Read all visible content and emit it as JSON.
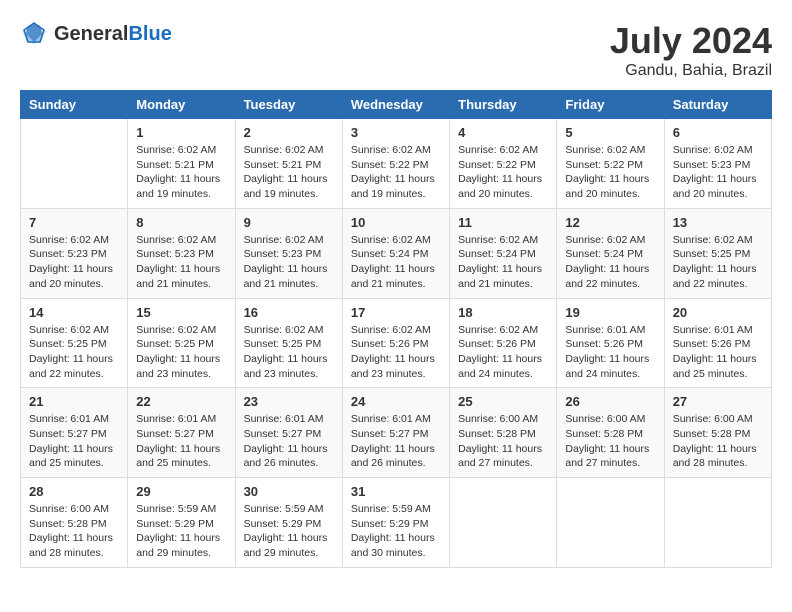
{
  "logo": {
    "general": "General",
    "blue": "Blue"
  },
  "title": {
    "month_year": "July 2024",
    "location": "Gandu, Bahia, Brazil"
  },
  "days_header": [
    "Sunday",
    "Monday",
    "Tuesday",
    "Wednesday",
    "Thursday",
    "Friday",
    "Saturday"
  ],
  "weeks": [
    [
      {
        "day": "",
        "info": ""
      },
      {
        "day": "1",
        "info": "Sunrise: 6:02 AM\nSunset: 5:21 PM\nDaylight: 11 hours\nand 19 minutes."
      },
      {
        "day": "2",
        "info": "Sunrise: 6:02 AM\nSunset: 5:21 PM\nDaylight: 11 hours\nand 19 minutes."
      },
      {
        "day": "3",
        "info": "Sunrise: 6:02 AM\nSunset: 5:22 PM\nDaylight: 11 hours\nand 19 minutes."
      },
      {
        "day": "4",
        "info": "Sunrise: 6:02 AM\nSunset: 5:22 PM\nDaylight: 11 hours\nand 20 minutes."
      },
      {
        "day": "5",
        "info": "Sunrise: 6:02 AM\nSunset: 5:22 PM\nDaylight: 11 hours\nand 20 minutes."
      },
      {
        "day": "6",
        "info": "Sunrise: 6:02 AM\nSunset: 5:23 PM\nDaylight: 11 hours\nand 20 minutes."
      }
    ],
    [
      {
        "day": "7",
        "info": "Sunrise: 6:02 AM\nSunset: 5:23 PM\nDaylight: 11 hours\nand 20 minutes."
      },
      {
        "day": "8",
        "info": "Sunrise: 6:02 AM\nSunset: 5:23 PM\nDaylight: 11 hours\nand 21 minutes."
      },
      {
        "day": "9",
        "info": "Sunrise: 6:02 AM\nSunset: 5:23 PM\nDaylight: 11 hours\nand 21 minutes."
      },
      {
        "day": "10",
        "info": "Sunrise: 6:02 AM\nSunset: 5:24 PM\nDaylight: 11 hours\nand 21 minutes."
      },
      {
        "day": "11",
        "info": "Sunrise: 6:02 AM\nSunset: 5:24 PM\nDaylight: 11 hours\nand 21 minutes."
      },
      {
        "day": "12",
        "info": "Sunrise: 6:02 AM\nSunset: 5:24 PM\nDaylight: 11 hours\nand 22 minutes."
      },
      {
        "day": "13",
        "info": "Sunrise: 6:02 AM\nSunset: 5:25 PM\nDaylight: 11 hours\nand 22 minutes."
      }
    ],
    [
      {
        "day": "14",
        "info": "Sunrise: 6:02 AM\nSunset: 5:25 PM\nDaylight: 11 hours\nand 22 minutes."
      },
      {
        "day": "15",
        "info": "Sunrise: 6:02 AM\nSunset: 5:25 PM\nDaylight: 11 hours\nand 23 minutes."
      },
      {
        "day": "16",
        "info": "Sunrise: 6:02 AM\nSunset: 5:25 PM\nDaylight: 11 hours\nand 23 minutes."
      },
      {
        "day": "17",
        "info": "Sunrise: 6:02 AM\nSunset: 5:26 PM\nDaylight: 11 hours\nand 23 minutes."
      },
      {
        "day": "18",
        "info": "Sunrise: 6:02 AM\nSunset: 5:26 PM\nDaylight: 11 hours\nand 24 minutes."
      },
      {
        "day": "19",
        "info": "Sunrise: 6:01 AM\nSunset: 5:26 PM\nDaylight: 11 hours\nand 24 minutes."
      },
      {
        "day": "20",
        "info": "Sunrise: 6:01 AM\nSunset: 5:26 PM\nDaylight: 11 hours\nand 25 minutes."
      }
    ],
    [
      {
        "day": "21",
        "info": "Sunrise: 6:01 AM\nSunset: 5:27 PM\nDaylight: 11 hours\nand 25 minutes."
      },
      {
        "day": "22",
        "info": "Sunrise: 6:01 AM\nSunset: 5:27 PM\nDaylight: 11 hours\nand 25 minutes."
      },
      {
        "day": "23",
        "info": "Sunrise: 6:01 AM\nSunset: 5:27 PM\nDaylight: 11 hours\nand 26 minutes."
      },
      {
        "day": "24",
        "info": "Sunrise: 6:01 AM\nSunset: 5:27 PM\nDaylight: 11 hours\nand 26 minutes."
      },
      {
        "day": "25",
        "info": "Sunrise: 6:00 AM\nSunset: 5:28 PM\nDaylight: 11 hours\nand 27 minutes."
      },
      {
        "day": "26",
        "info": "Sunrise: 6:00 AM\nSunset: 5:28 PM\nDaylight: 11 hours\nand 27 minutes."
      },
      {
        "day": "27",
        "info": "Sunrise: 6:00 AM\nSunset: 5:28 PM\nDaylight: 11 hours\nand 28 minutes."
      }
    ],
    [
      {
        "day": "28",
        "info": "Sunrise: 6:00 AM\nSunset: 5:28 PM\nDaylight: 11 hours\nand 28 minutes."
      },
      {
        "day": "29",
        "info": "Sunrise: 5:59 AM\nSunset: 5:29 PM\nDaylight: 11 hours\nand 29 minutes."
      },
      {
        "day": "30",
        "info": "Sunrise: 5:59 AM\nSunset: 5:29 PM\nDaylight: 11 hours\nand 29 minutes."
      },
      {
        "day": "31",
        "info": "Sunrise: 5:59 AM\nSunset: 5:29 PM\nDaylight: 11 hours\nand 30 minutes."
      },
      {
        "day": "",
        "info": ""
      },
      {
        "day": "",
        "info": ""
      },
      {
        "day": "",
        "info": ""
      }
    ]
  ]
}
